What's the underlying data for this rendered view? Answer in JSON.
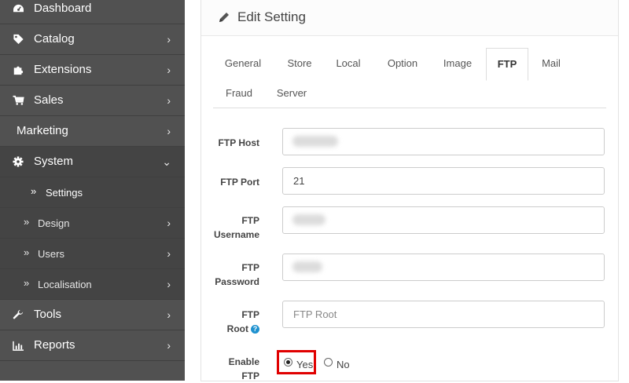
{
  "sidebar": {
    "items": [
      {
        "label": "Dashboard",
        "icon": "dashboard-icon"
      },
      {
        "label": "Catalog",
        "icon": "tag-icon"
      },
      {
        "label": "Extensions",
        "icon": "puzzle-icon"
      },
      {
        "label": "Sales",
        "icon": "cart-icon"
      },
      {
        "label": "Marketing",
        "icon": "share-icon"
      },
      {
        "label": "System",
        "icon": "gear-icon"
      },
      {
        "label": "Tools",
        "icon": "wrench-icon"
      },
      {
        "label": "Reports",
        "icon": "bar-chart-icon"
      }
    ],
    "system_children": [
      {
        "label": "Settings"
      },
      {
        "label": "Design"
      },
      {
        "label": "Users"
      },
      {
        "label": "Localisation"
      }
    ]
  },
  "panel": {
    "title": "Edit Setting",
    "icon": "pencil-icon"
  },
  "tabs": [
    {
      "label": "General"
    },
    {
      "label": "Store"
    },
    {
      "label": "Local"
    },
    {
      "label": "Option"
    },
    {
      "label": "Image"
    },
    {
      "label": "FTP",
      "active": true
    },
    {
      "label": "Mail"
    },
    {
      "label": "Fraud"
    },
    {
      "label": "Server"
    }
  ],
  "form": {
    "ftp_host": {
      "label": "FTP Host",
      "value": ""
    },
    "ftp_port": {
      "label": "FTP Port",
      "value": "21"
    },
    "ftp_username": {
      "label_line1": "FTP",
      "label_line2": "Username",
      "value": ""
    },
    "ftp_password": {
      "label_line1": "FTP",
      "label_line2": "Password",
      "value": ""
    },
    "ftp_root": {
      "label_line1": "FTP",
      "label_line2": "Root",
      "placeholder": "FTP Root",
      "help_icon": "question-circle-icon"
    },
    "enable_ftp": {
      "label_line1": "Enable",
      "label_line2": "FTP",
      "options": [
        "Yes",
        "No"
      ],
      "selected": "Yes"
    }
  },
  "colors": {
    "sidebar_bg": "#515151",
    "sidebar_active": "#444444",
    "highlight_border": "#e00000",
    "help_blue": "#1e91cf"
  }
}
